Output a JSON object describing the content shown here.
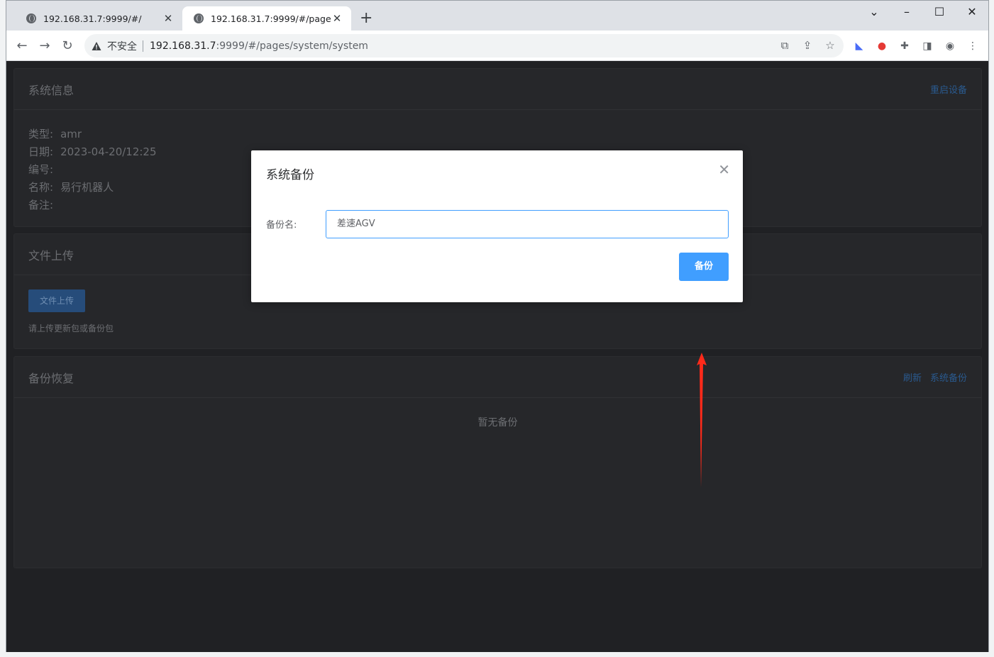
{
  "browser": {
    "tabs": [
      {
        "title": "192.168.31.7:9999/#/"
      },
      {
        "title": "192.168.31.7:9999/#/pages/sy"
      }
    ],
    "security_label": "不安全",
    "url_host": "192.168.31.7",
    "url_rest": ":9999/#/pages/system/system"
  },
  "system_info": {
    "title": "系统信息",
    "reboot_label": "重启设备",
    "rows": [
      {
        "label": "类型:",
        "value": "amr"
      },
      {
        "label": "日期:",
        "value": "2023-04-20/12:25"
      },
      {
        "label": "编号:",
        "value": ""
      },
      {
        "label": "名称:",
        "value": "易行机器人"
      },
      {
        "label": "备注:",
        "value": ""
      }
    ]
  },
  "file_upload": {
    "title": "文件上传",
    "button_label": "文件上传",
    "hint": "请上传更新包或备份包"
  },
  "backup_restore": {
    "title": "备份恢复",
    "refresh_label": "刷新",
    "system_backup_label": "系统备份",
    "empty_text": "暂无备份"
  },
  "dialog": {
    "title": "系统备份",
    "field_label": "备份名:",
    "field_value": "差速AGV",
    "submit_label": "备份"
  },
  "colors": {
    "accent": "#409eff",
    "annotation_arrow": "#ff2a1a"
  }
}
